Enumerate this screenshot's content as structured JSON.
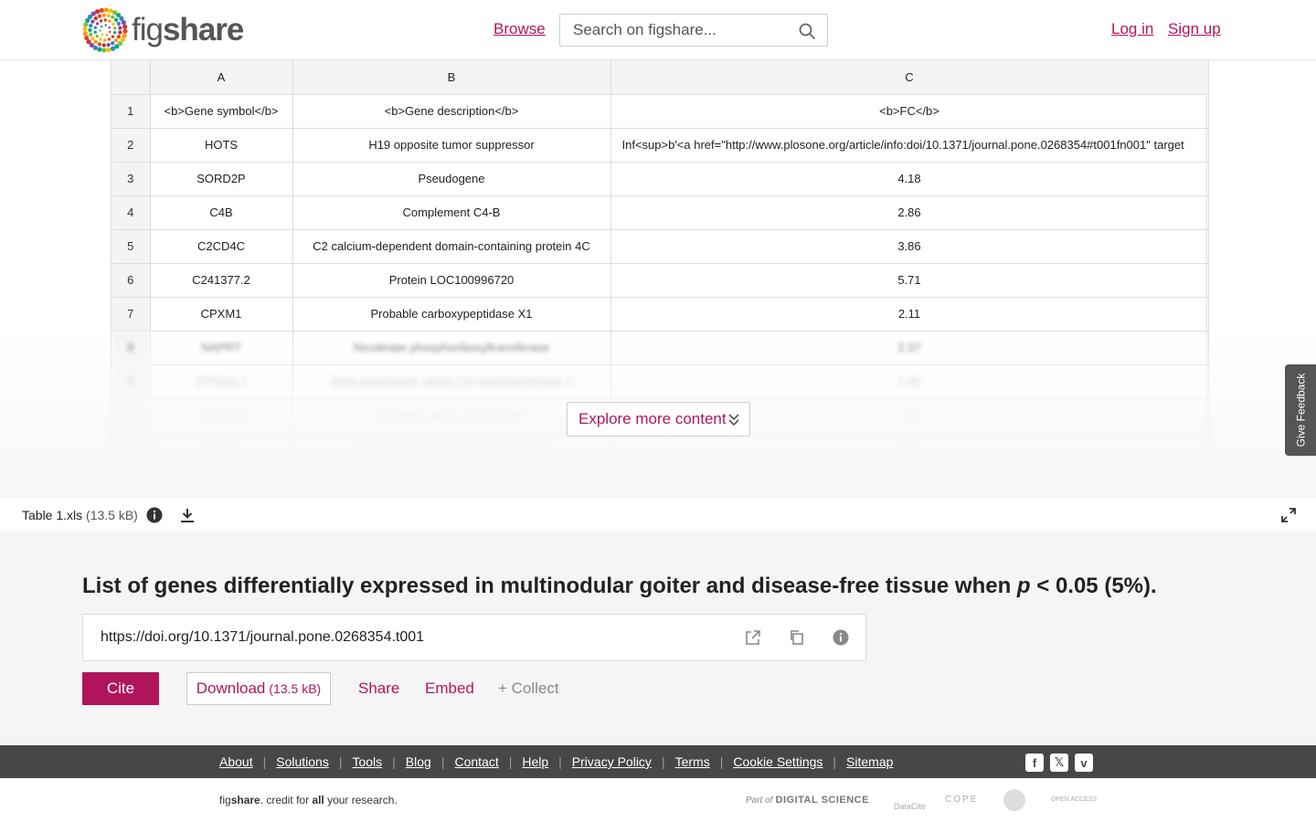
{
  "header": {
    "logo_light": "fig",
    "logo_bold": "share",
    "browse": "Browse",
    "search_placeholder": "Search on figshare...",
    "login": "Log in",
    "signup": "Sign up"
  },
  "sheet": {
    "columns": [
      "A",
      "B",
      "C"
    ],
    "rows": [
      [
        "1",
        "<b>Gene symbol</b>",
        "<b>Gene description</b>",
        "<b>FC</b>"
      ],
      [
        "2",
        "HOTS",
        "H19 opposite tumor suppressor",
        "Inf<sup>b'<a href=\"http://www.plosone.org/article/info:doi/10.1371/journal.pone.0268354#t001fn001\" target"
      ],
      [
        "3",
        "SORD2P",
        "Pseudogene",
        "4.18"
      ],
      [
        "4",
        "C4B",
        "Complement C4-B",
        "2.86"
      ],
      [
        "5",
        "C2CD4C",
        "C2 calcium-dependent domain-containing protein 4C",
        "3.86"
      ],
      [
        "6",
        "C241377.2",
        "Protein LOC100996720",
        "5.71"
      ],
      [
        "7",
        "CPXM1",
        "Probable carboxypeptidase X1",
        "2.11"
      ],
      [
        "8",
        "NAPRT",
        "Nicotinate phosphoribosyltransferase",
        "2.37"
      ],
      [
        "9",
        "ST6GAL1",
        "Beta-galactoside alpha-2,6-sialyltransferase 1",
        "1.86"
      ],
      [
        "10",
        "COL14A1",
        "Collagen alpha-1(XIV) chain",
        "1.63"
      ],
      [
        "11",
        "HSPA2",
        "Heat shock-related 70 kDa protein 2",
        "1.57"
      ]
    ]
  },
  "explore": "Explore more content",
  "feedback": "Give Feedback",
  "file": {
    "name": "Table 1.xls",
    "size": "(13.5 kB)"
  },
  "meta": {
    "title_before": "List of genes differentially expressed in multinodular goiter and disease-free tissue when ",
    "title_italic": "p",
    "title_after": " < 0.05 (5%).",
    "doi": "https://doi.org/10.1371/journal.pone.0268354.t001",
    "cite": "Cite",
    "download": "Download",
    "download_size": "(13.5 kB)",
    "share": "Share",
    "embed": "Embed",
    "collect": "+ Collect"
  },
  "footer": {
    "links": [
      "About",
      "Solutions",
      "Tools",
      "Blog",
      "Contact",
      "Help",
      "Privacy Policy",
      "Terms",
      "Cookie Settings",
      "Sitemap"
    ],
    "tagline_a": "fig",
    "tagline_b": "share",
    "tagline_c": ". credit for ",
    "tagline_d": "all",
    "tagline_e": " your research.",
    "partner_ds_prefix": "Part of",
    "partner_ds": "DIGITAL SCIENCE",
    "partner_datacite": "DataCite",
    "partner_cope": "COPE",
    "partner_oa": "OPEN ACCESS"
  },
  "colors": {
    "accent": "#b0155c",
    "footer_bg": "#474747",
    "meta_bg": "#f5f5f5"
  },
  "icons": [
    "search-icon",
    "info-icon",
    "download-icon",
    "expand-icon",
    "external-link-icon",
    "copy-icon",
    "chevron-double-down-icon",
    "facebook-icon",
    "x-icon",
    "vimeo-icon"
  ]
}
